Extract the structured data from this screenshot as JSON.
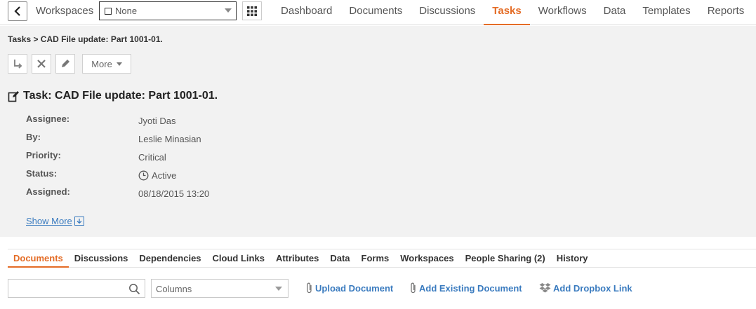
{
  "topbar": {
    "workspaces_label": "Workspaces",
    "workspace_select_value": "None",
    "nav": [
      {
        "label": "Dashboard"
      },
      {
        "label": "Documents"
      },
      {
        "label": "Discussions"
      },
      {
        "label": "Tasks"
      },
      {
        "label": "Workflows"
      },
      {
        "label": "Data"
      },
      {
        "label": "Templates"
      },
      {
        "label": "Reports"
      }
    ],
    "active_nav": "Tasks"
  },
  "breadcrumb": "Tasks > CAD File update: Part 1001-01.",
  "actions": {
    "more_label": "More"
  },
  "task": {
    "title": "Task: CAD File update: Part 1001-01.",
    "fields": [
      {
        "label": "Assignee:",
        "value": "Jyoti Das"
      },
      {
        "label": "By:",
        "value": "Leslie Minasian"
      },
      {
        "label": "Priority:",
        "value": "Critical"
      },
      {
        "label": "Status:",
        "value": "Active"
      },
      {
        "label": "Assigned:",
        "value": "08/18/2015 13:20"
      }
    ],
    "show_more": "Show More"
  },
  "tabs": [
    {
      "label": "Documents"
    },
    {
      "label": "Discussions"
    },
    {
      "label": "Dependencies"
    },
    {
      "label": "Cloud Links"
    },
    {
      "label": "Attributes"
    },
    {
      "label": "Data"
    },
    {
      "label": "Forms"
    },
    {
      "label": "Workspaces"
    },
    {
      "label": "People Sharing (2)"
    },
    {
      "label": "History"
    }
  ],
  "active_tab": "Documents",
  "toolbar": {
    "search_value": "",
    "columns_label": "Columns",
    "upload_label": "Upload Document",
    "add_existing_label": "Add Existing Document",
    "add_dropbox_label": "Add Dropbox Link"
  },
  "colors": {
    "accent": "#e46c26",
    "link": "#3a7bbf",
    "header_bg": "#f2f2f2"
  }
}
